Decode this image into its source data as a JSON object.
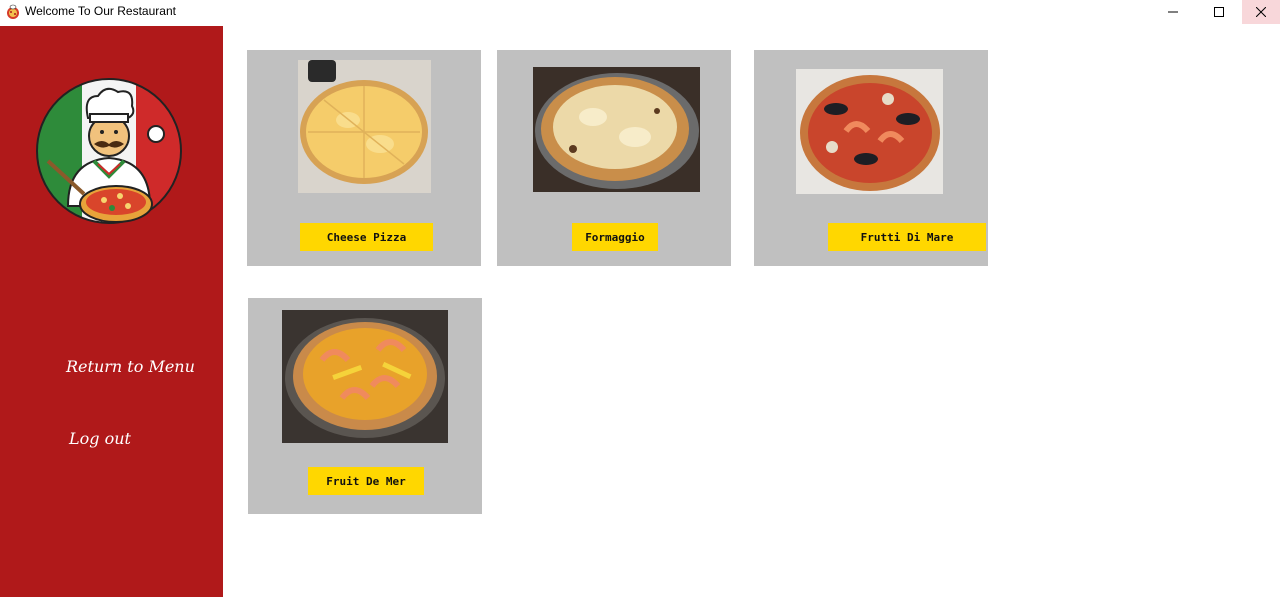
{
  "window": {
    "title": "Welcome To Our Restaurant",
    "controls": [
      "minimize-icon",
      "maximize-icon",
      "close-icon"
    ]
  },
  "sidebar": {
    "logo_icon": "chef-with-pizza-icon",
    "items": [
      {
        "label": "Return to Menu"
      },
      {
        "label": "Log out"
      }
    ]
  },
  "menu": {
    "items": [
      {
        "label": "Cheese Pizza",
        "photo": "cheese-pizza-photo"
      },
      {
        "label": "Formaggio",
        "photo": "formaggio-photo"
      },
      {
        "label": "Frutti Di Mare",
        "photo": "frutti-di-mare-photo"
      },
      {
        "label": "Fruit De Mer",
        "photo": "fruit-de-mer-photo"
      }
    ]
  },
  "colors": {
    "sidebar": "#b0191a",
    "card": "#c0c0c0",
    "button": "#ffd700",
    "close_hover": "#f8d7da"
  }
}
